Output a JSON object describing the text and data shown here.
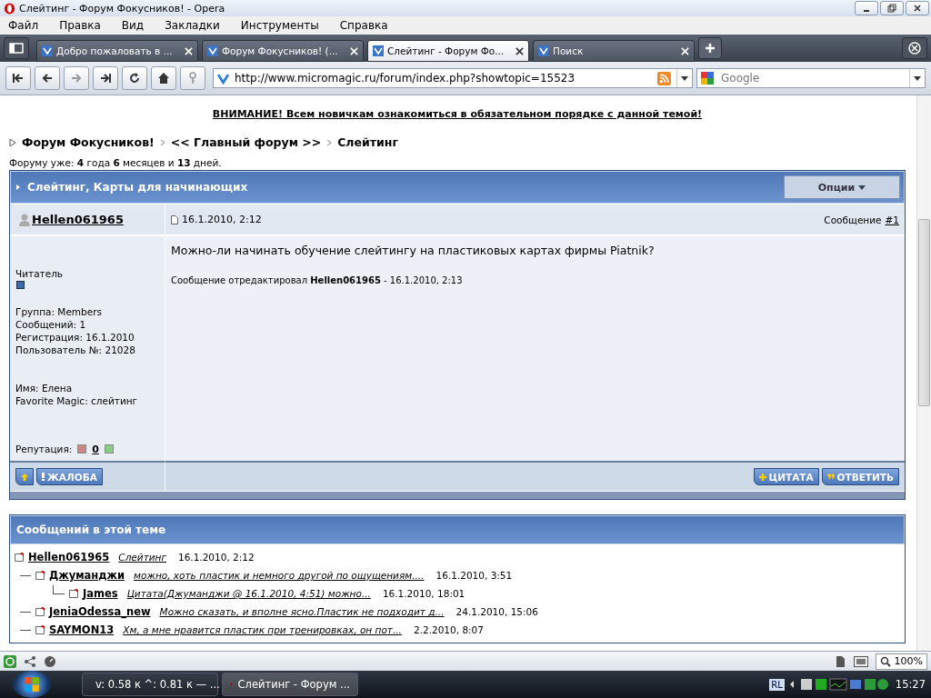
{
  "window": {
    "title": "Слейтинг - Форум Фокусников! - Opera"
  },
  "menu": [
    "Файл",
    "Правка",
    "Вид",
    "Закладки",
    "Инструменты",
    "Справка"
  ],
  "tabs": [
    {
      "label": "Добро пожаловать в ...",
      "selected": false
    },
    {
      "label": "Форум Фокусников! (...",
      "selected": false
    },
    {
      "label": "Слейтинг - Форум Фо...",
      "selected": true
    },
    {
      "label": "Поиск",
      "selected": false
    }
  ],
  "address": {
    "value": "http://www.micromagic.ru/forum/index.php?showtopic=15523"
  },
  "search": {
    "placeholder": "Google"
  },
  "page": {
    "notice": "ВНИМАНИЕ! Всем новичкам ознакомиться в обязательном порядке с данной темой!",
    "breadcrumb": [
      "Форум Фокусников!",
      "<< Главный форум >>",
      "Слейтинг"
    ],
    "forum_age": "Форуму уже: **4** года **6** месяцев и **13** дней.",
    "topic": {
      "title": "Слейтинг, Карты для начинающих",
      "options_button": "Опции"
    },
    "post": {
      "author": "Hellen061965",
      "date": "16.1.2010, 2:12",
      "number_label": "Сообщение",
      "number": "#1",
      "body": "Можно-ли начинать обучение слейтингу на пластиковых картах фирмы Piatnik?",
      "edit_note": "Сообщение отредактировал **Hellen061965** - 16.1.2010, 2:13",
      "rank": "Читатель",
      "details": [
        "Группа: Members",
        "Сообщений: 1",
        "Регистрация: 16.1.2010",
        "Пользователь №: 21028"
      ],
      "profile": [
        "Имя: Елена",
        "Favorite Magic: слейтинг"
      ],
      "reputation_label": "Репутация:",
      "reputation": "0",
      "complaint_button": "ЖАЛОБА",
      "quote_button": "ЦИТАТА",
      "reply_button": "ОТВЕТИТЬ"
    },
    "thread": {
      "title": "Сообщений в этой теме",
      "items": [
        {
          "author": "Hellen061965",
          "excerpt": "Слейтинг",
          "date": "16.1.2010, 2:12",
          "children": [
            {
              "author": "Джуманджи",
              "excerpt": "можно, хоть пластик и немного другой по ощущениям....",
              "date": "16.1.2010, 3:51",
              "children": [
                {
                  "author": "James",
                  "excerpt": "Цитата(Джуманджи @ 16.1.2010, 4:51) можно...",
                  "date": "16.1.2010, 18:01"
                }
              ]
            },
            {
              "author": "JeniaOdessa_new",
              "excerpt": "Можно сказать, и вполне ясно.Пластик не подходит д...",
              "date": "24.1.2010, 15:06"
            },
            {
              "author": "SAYMON13",
              "excerpt": "Хм, а мне нравится пластик при тренировках, он пот...",
              "date": "2.2.2010, 8:07"
            }
          ]
        }
      ]
    }
  },
  "status_bar": {
    "zoom": "100%"
  },
  "taskbar": {
    "tasks": [
      {
        "label": "v: 0.58 к ^: 0.81 к — ...",
        "selected": false
      },
      {
        "label": "Слейтинг - Форум ...",
        "selected": true
      }
    ],
    "language": "RL",
    "clock": "15:27"
  }
}
